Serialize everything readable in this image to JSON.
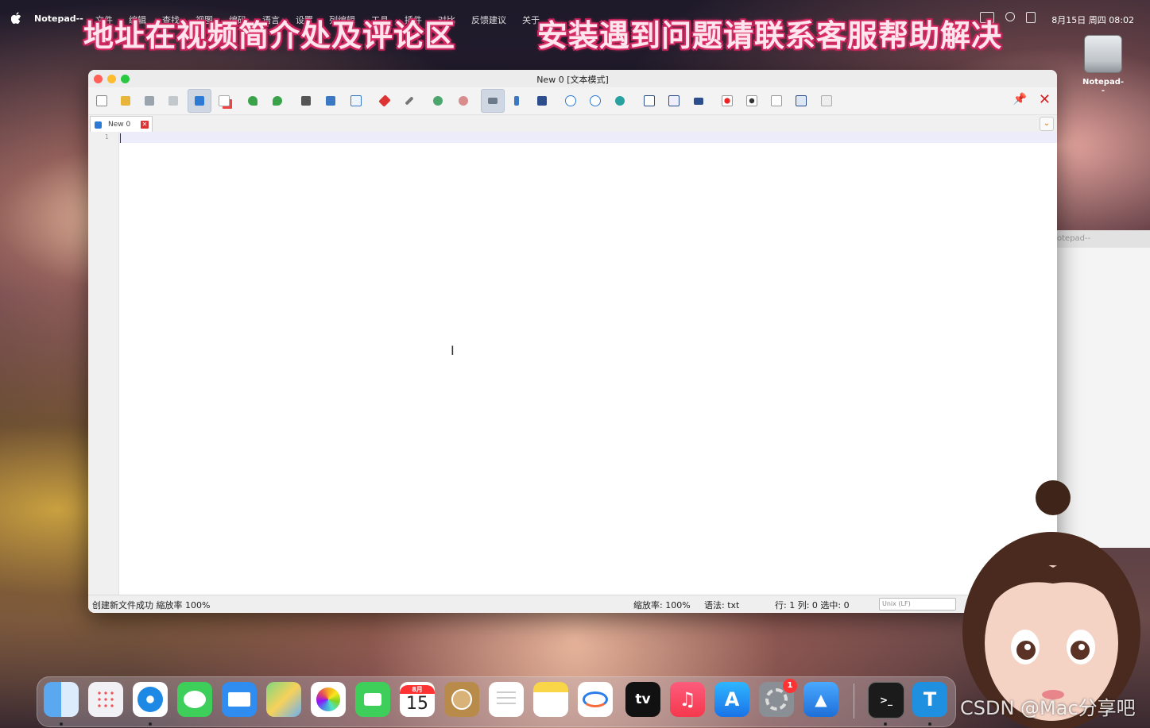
{
  "menubar": {
    "app_name": "Notepad--",
    "items": [
      "文件",
      "编辑",
      "查找",
      "视图",
      "编码",
      "语言",
      "设置",
      "列编辑",
      "工具",
      "插件",
      "对比",
      "反馈建议",
      "关于"
    ],
    "clock": "8月15日 周四 08:02"
  },
  "banner": {
    "left": "地址在视频简介处及评论区",
    "right": "安装遇到问题请联系客服帮助解决"
  },
  "desktop": {
    "drive_label": "Notepad--",
    "bg_window_title": "otepad--"
  },
  "window": {
    "title": "New 0 [文本模式]",
    "tab_label": "New 0",
    "tab_close": "✕",
    "line_number": "1"
  },
  "statusbar": {
    "message": "创建新文件成功 縮放率 100%",
    "zoom": "缩放率: 100%",
    "syntax": "语法: txt",
    "position": "行: 1 列: 0 选中: 0",
    "encoding": "Unix (LF)"
  },
  "dock": {
    "calendar_month": "8月",
    "calendar_day": "15",
    "settings_badge": "1",
    "tv_label": "tv",
    "text_app_label": "T",
    "terminal_label": ">_"
  },
  "watermark": "CSDN @Mac分享吧",
  "colors": {
    "close_red": "#ff5f57",
    "minimize_yellow": "#febc2e",
    "zoom_green": "#28c840",
    "banner_stroke": "#c0205a",
    "toolbar_close": "#d62020"
  }
}
